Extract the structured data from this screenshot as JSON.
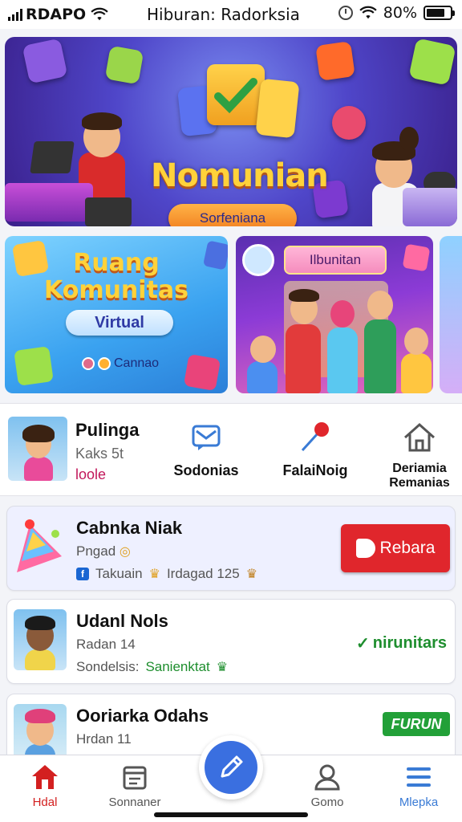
{
  "status_bar": {
    "carrier": "RDAPO",
    "title": "Hiburan: Radorksia",
    "battery_text": "80%",
    "battery_level": 0.8
  },
  "hero": {
    "title": "Nomunian",
    "button": "Sorfeniana"
  },
  "cards": {
    "ruang": {
      "line1": "Ruang",
      "line2": "Komunitas",
      "pill": "Virtual",
      "footer": "Cannao"
    },
    "ilbunitan": {
      "title": "Ilbunitan"
    }
  },
  "profile": {
    "name": "Pulinga",
    "subtitle": "Kaks 5t",
    "link": "loole",
    "actions": [
      {
        "label": "Sodonias",
        "icon": "message-icon"
      },
      {
        "label": "FalaiNoig",
        "icon": "pin-icon"
      },
      {
        "label": "Deriamia Remanias",
        "icon": "home-icon"
      }
    ]
  },
  "list": [
    {
      "title": "Cabnka Niak",
      "subtitle": "Pngad",
      "meta1": "Takuain",
      "meta2": "Irdagad 125",
      "button": "Rebara"
    },
    {
      "title": "Udanl Nols",
      "subtitle": "Radan 14",
      "meta_label": "Sondelsis:",
      "meta_value": "Sanienktat",
      "tag": "nirunitars"
    },
    {
      "title": "Ooriarka Odahs",
      "subtitle": "Hrdan 11",
      "badge": "FURUN"
    }
  ],
  "bottom_nav": [
    {
      "label": "Hdal",
      "icon": "home-icon",
      "active": true
    },
    {
      "label": "Sonnaner",
      "icon": "calendar-icon"
    },
    {
      "label": "Gomo",
      "icon": "person-icon"
    },
    {
      "label": "Mlepka",
      "icon": "menu-icon"
    }
  ],
  "colors": {
    "accent_red": "#e0262c",
    "accent_blue": "#3a6fe0",
    "accent_green": "#1e8e2e",
    "hero_gold": "#ffd23a"
  }
}
